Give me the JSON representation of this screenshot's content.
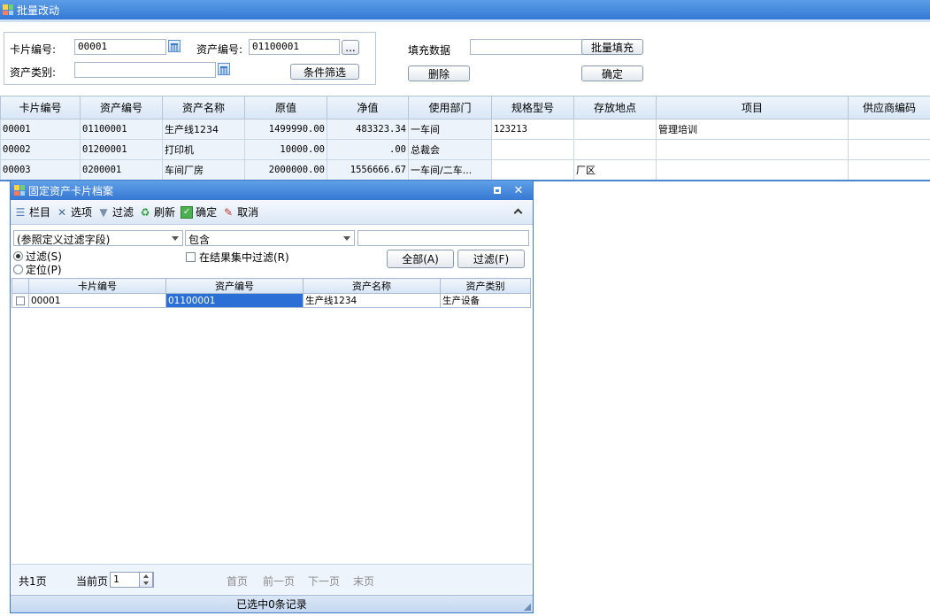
{
  "window": {
    "title": "批量改动",
    "icon": "app-grid-icon"
  },
  "filters": {
    "card_no_label": "卡片编号:",
    "card_no_value": "00001",
    "asset_no_label": "资产编号:",
    "asset_no_value": "01100001",
    "ellipsis": "...",
    "asset_category_label": "资产类别:",
    "asset_category_value": "",
    "condition_filter_button": "条件筛选"
  },
  "fill": {
    "label": "填充数据",
    "value": "",
    "batch_fill_button": "批量填充",
    "delete_button": "删除",
    "confirm_button": "确定"
  },
  "main_table": {
    "columns": [
      "卡片编号",
      "资产编号",
      "资产名称",
      "原值",
      "净值",
      "使用部门",
      "规格型号",
      "存放地点",
      "项目",
      "供应商编码"
    ],
    "rows": [
      [
        "00001",
        "01100001",
        "生产线1234",
        "1499990.00",
        "483323.34",
        "一车间",
        "123213",
        "",
        "管理培训",
        ""
      ],
      [
        "00002",
        "01200001",
        "打印机",
        "10000.00",
        ".00",
        "总裁会",
        "",
        "",
        "",
        ""
      ],
      [
        "00003",
        "0200001",
        "车间厂房",
        "2000000.00",
        "1556666.67",
        "一车间/二车...",
        "",
        "厂区",
        "",
        ""
      ]
    ]
  },
  "dialog": {
    "title": "固定资产卡片档案",
    "toolbar": {
      "columns": "栏目",
      "options": "选项",
      "filter": "过滤",
      "refresh": "刷新",
      "confirm": "确定",
      "cancel": "取消"
    },
    "field_select": "(参照定义过滤字段)",
    "operator_select": "包含",
    "filter_value": "",
    "radio_filter": "过滤(S)",
    "radio_locate": "定位(P)",
    "in_result_filter": "在结果集中过滤(R)",
    "all_button": "全部(A)",
    "filter_button": "过滤(F)",
    "columns": [
      "卡片编号",
      "资产编号",
      "资产名称",
      "资产类别"
    ],
    "rows": [
      {
        "card_no": "00001",
        "asset_no": "01100001",
        "asset_name": "生产线1234",
        "category": "生产设备"
      }
    ],
    "pager": {
      "total_pages": "共1页",
      "current_page_label": "当前页",
      "current_page": "1",
      "first": "首页",
      "prev": "前一页",
      "next": "下一页",
      "last": "末页"
    },
    "status": "已选中0条记录"
  },
  "colors": {
    "title_bar": "#3479d6",
    "selection": "#2a6fd6",
    "header_bg": "#d8e6f6"
  }
}
